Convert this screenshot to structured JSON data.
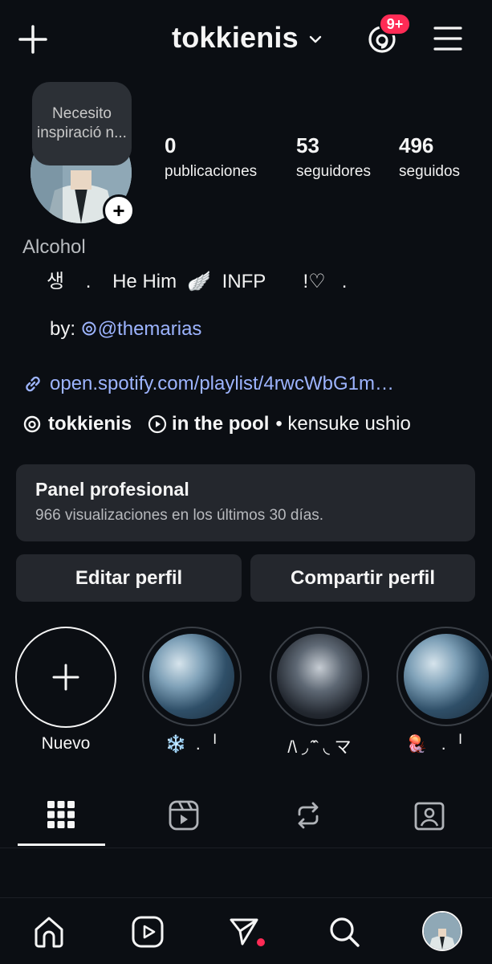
{
  "header": {
    "username": "tokkienis",
    "notification_badge": "9+"
  },
  "profile": {
    "note_text": "Necesito inspiració n...",
    "stats": [
      {
        "value": "0",
        "label": "publicaciones"
      },
      {
        "value": "53",
        "label": "seguidores"
      },
      {
        "value": "496",
        "label": "seguidos"
      }
    ],
    "name": "Alcohol",
    "bio_line1": "생    .    He Him  🪽  INFP       !♡   .",
    "bio_line2_prefix": "by: ",
    "bio_line2_link": "@themarias",
    "link_url": "open.spotify.com/playlist/4rwcWbG1m…",
    "threads_username": "tokkienis",
    "music_title": "in the pool",
    "music_artist": "• kensuke ushio"
  },
  "professional_panel": {
    "title": "Panel profesional",
    "subtitle": "966 visualizaciones en los últimos 30 días."
  },
  "buttons": {
    "edit": "Editar perfil",
    "share": "Compartir perfil"
  },
  "highlights": [
    {
      "label": "Nuevo"
    },
    {
      "label": "❄️  .  ╵"
    },
    {
      "label": "/\\ ◞ ̑̑ˆ ◟ マ"
    },
    {
      "label": "🪼   .  ╵"
    }
  ],
  "colors": {
    "background": "#0b0e13",
    "surface": "#24272d",
    "link": "#9db4ff",
    "badge": "#ff2b55"
  }
}
